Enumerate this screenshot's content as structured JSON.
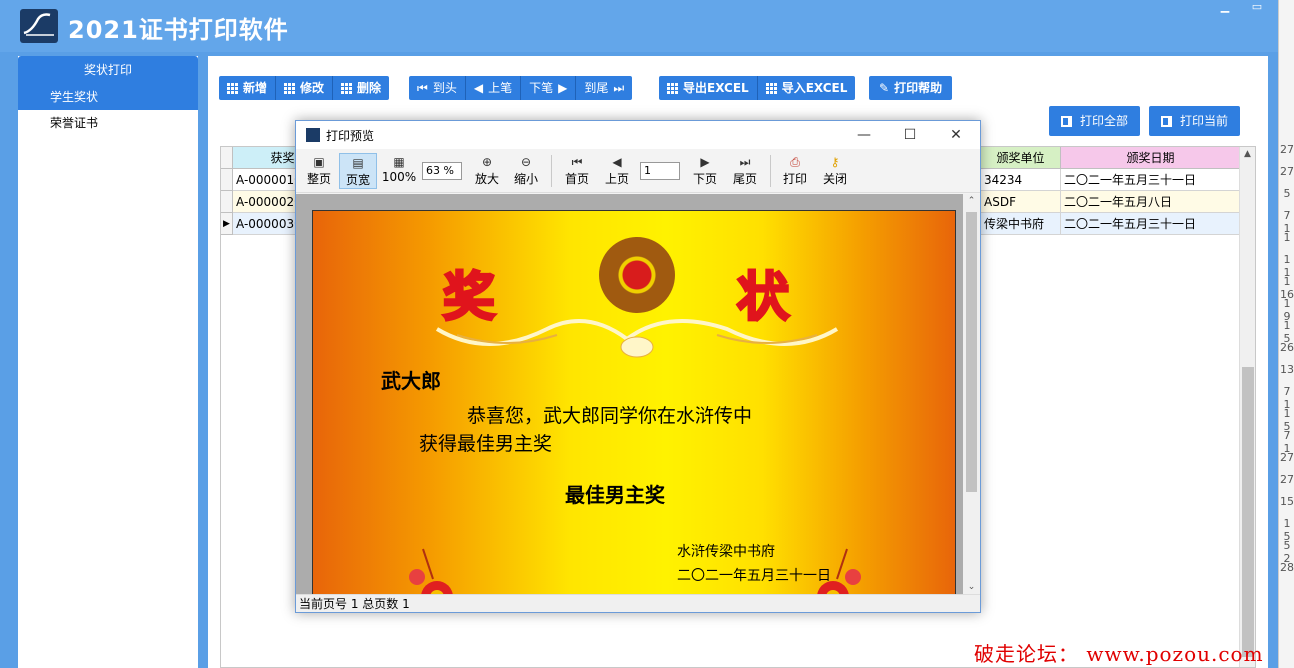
{
  "app": {
    "title": "2021证书打印软件"
  },
  "sidebar": {
    "header": "奖状打印",
    "items": [
      {
        "label": "学生奖状",
        "active": true
      },
      {
        "label": "荣誉证书",
        "active": false
      }
    ]
  },
  "toolbar": {
    "add": "新增",
    "edit": "修改",
    "delete": "删除",
    "first": "到头",
    "prev": "上笔",
    "next": "下笔",
    "last": "到尾",
    "export_excel": "导出EXCEL",
    "import_excel": "导入EXCEL",
    "help": "打印帮助",
    "print_all": "打印全部",
    "print_current": "打印当前"
  },
  "grid": {
    "columns": [
      {
        "label": "获奖",
        "color": "#cdeff8"
      },
      {
        "label": "颁奖单位",
        "color": "#d6f0c4"
      },
      {
        "label": "颁奖日期",
        "color": "#f6c8ea"
      }
    ],
    "rows": [
      {
        "id": "A-000001号",
        "unit": "34234",
        "date": "二〇二一年五月三十一日"
      },
      {
        "id": "A-000002号",
        "unit": "ASDF",
        "date": "二〇二一年五月八日"
      },
      {
        "id": "A-000003号",
        "unit": "传梁中书府",
        "date": "二〇二一年五月三十一日"
      }
    ]
  },
  "right_strip": [
    "27",
    "27",
    "5",
    "7 1",
    "1",
    "1 1",
    "1 16",
    "1 9",
    "1 5",
    "26",
    "13",
    "7 1",
    "1 5",
    "7 1",
    "27",
    "27",
    "15",
    "1 5",
    "5 2",
    "28"
  ],
  "dialog": {
    "title": "打印预览",
    "tools": {
      "whole_page": "整页",
      "page_width": "页宽",
      "zoom100": "100%",
      "zoom_in": "放大",
      "zoom_out": "缩小",
      "first_page": "首页",
      "prev_page": "上页",
      "next_page": "下页",
      "last_page": "尾页",
      "print": "打印",
      "close": "关闭"
    },
    "zoom_value": "63 %",
    "page_value": "1",
    "status": "当前页号  1    总页数  1"
  },
  "certificate": {
    "left_char": "奖",
    "right_char": "状",
    "name": "武大郎",
    "line1": "恭喜您，武大郎同学你在水浒传中",
    "line2": "获得最佳男主奖",
    "award": "最佳男主奖",
    "issuer": "水浒传梁中书府",
    "date": "二〇二一年五月三十一日"
  },
  "watermark": "破走论坛： www.pozou.com",
  "colors": {
    "accent": "#2f7ee0",
    "frame": "#5a9fe6"
  }
}
